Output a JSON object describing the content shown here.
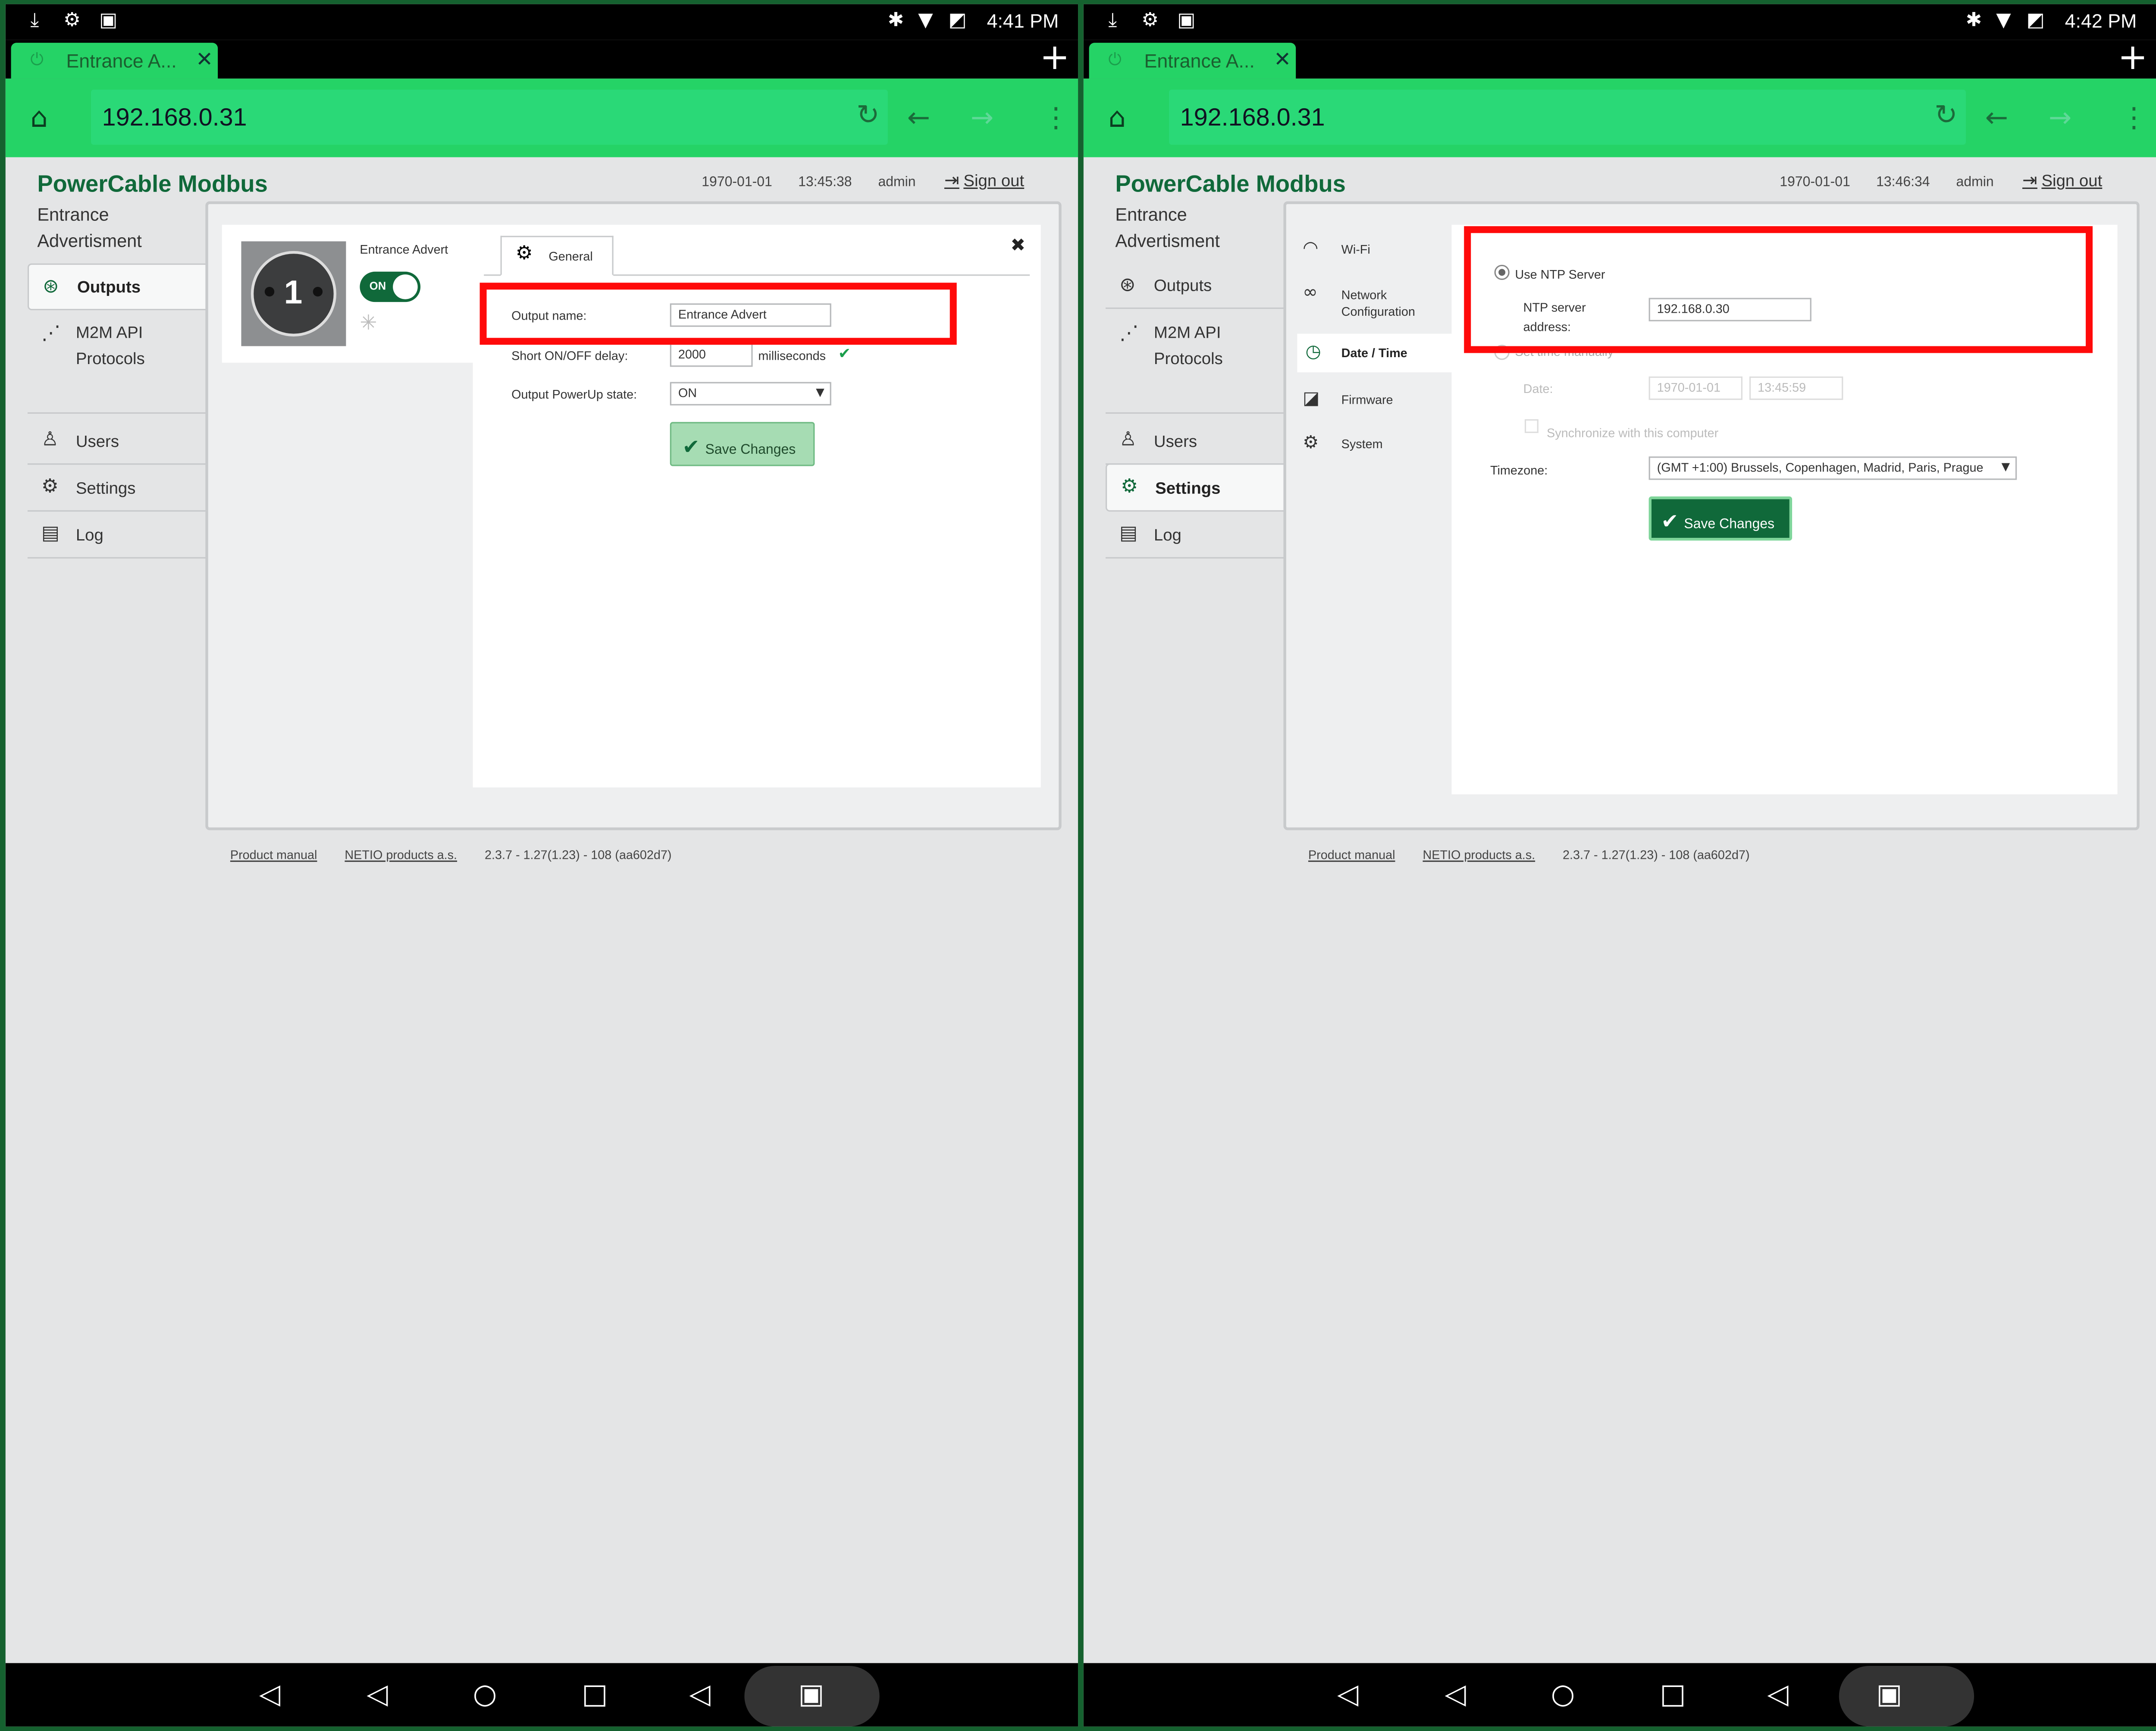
{
  "left": {
    "status_time": "4:41 PM",
    "tab_title": "Entrance A...",
    "url": "192.168.0.31",
    "brand": "PowerCable Modbus",
    "device_name": "Entrance Advertisment",
    "header": {
      "date": "1970-01-01",
      "time": "13:45:38",
      "user": "admin",
      "sign_out": "Sign out"
    },
    "sidebar": [
      {
        "label": "Outputs",
        "icon": "outputs-icon",
        "active": true
      },
      {
        "label": "M2M API Protocols",
        "icon": "m2m-icon",
        "active": false
      },
      {
        "label": "Users",
        "icon": "user-icon",
        "active": false
      },
      {
        "label": "Settings",
        "icon": "gear-icon",
        "active": false
      },
      {
        "label": "Log",
        "icon": "log-icon",
        "active": false
      }
    ],
    "output_card": {
      "number": "1",
      "name": "Entrance Advert",
      "toggle": "ON"
    },
    "tab_general": "General",
    "form": {
      "output_name_label": "Output name:",
      "output_name_value": "Entrance Advert",
      "delay_label": "Short ON/OFF delay:",
      "delay_value": "2000",
      "delay_unit": "milliseconds",
      "powerup_label": "Output PowerUp state:",
      "powerup_value": "ON",
      "save": "Save Changes"
    },
    "footer": {
      "manual": "Product manual",
      "company": "NETIO products a.s.",
      "version": "2.3.7 - 1.27(1.23) - 108 (aa602d7)"
    }
  },
  "right": {
    "status_time": "4:42 PM",
    "tab_title": "Entrance A...",
    "url": "192.168.0.31",
    "brand": "PowerCable Modbus",
    "device_name": "Entrance Advertisment",
    "header": {
      "date": "1970-01-01",
      "time": "13:46:34",
      "user": "admin",
      "sign_out": "Sign out"
    },
    "sidebar": [
      {
        "label": "Outputs",
        "icon": "outputs-icon",
        "active": false
      },
      {
        "label": "M2M API Protocols",
        "icon": "m2m-icon",
        "active": false
      },
      {
        "label": "Users",
        "icon": "user-icon",
        "active": false
      },
      {
        "label": "Settings",
        "icon": "gear-icon",
        "active": true
      },
      {
        "label": "Log",
        "icon": "log-icon",
        "active": false
      }
    ],
    "submenu": [
      {
        "label": "Wi-Fi",
        "icon": "wifi-icon",
        "active": false
      },
      {
        "label": "Network Configuration",
        "icon": "network-icon",
        "active": false
      },
      {
        "label": "Date / Time",
        "icon": "clock-icon",
        "active": true
      },
      {
        "label": "Firmware",
        "icon": "firmware-icon",
        "active": false
      },
      {
        "label": "System",
        "icon": "gear-icon",
        "active": false
      }
    ],
    "datetime": {
      "use_ntp": "Use NTP Server",
      "ntp_label": "NTP server address:",
      "ntp_value": "192.168.0.30",
      "set_manually": "Set time manually",
      "date_label": "Date:",
      "date_value": "1970-01-01",
      "time_value": "13:45:59",
      "sync_label": "Synchronize with this computer",
      "timezone_label": "Timezone:",
      "timezone_value": "(GMT +1:00) Brussels, Copenhagen, Madrid, Paris, Prague",
      "save": "Save Changes"
    },
    "footer": {
      "manual": "Product manual",
      "company": "NETIO products a.s.",
      "version": "2.3.7 - 1.27(1.23) - 108 (aa602d7)"
    }
  },
  "colors": {
    "accent": "#25d366",
    "brand": "#10693a",
    "highlight": "#ff0a0a",
    "background": "#e4e5e6"
  }
}
